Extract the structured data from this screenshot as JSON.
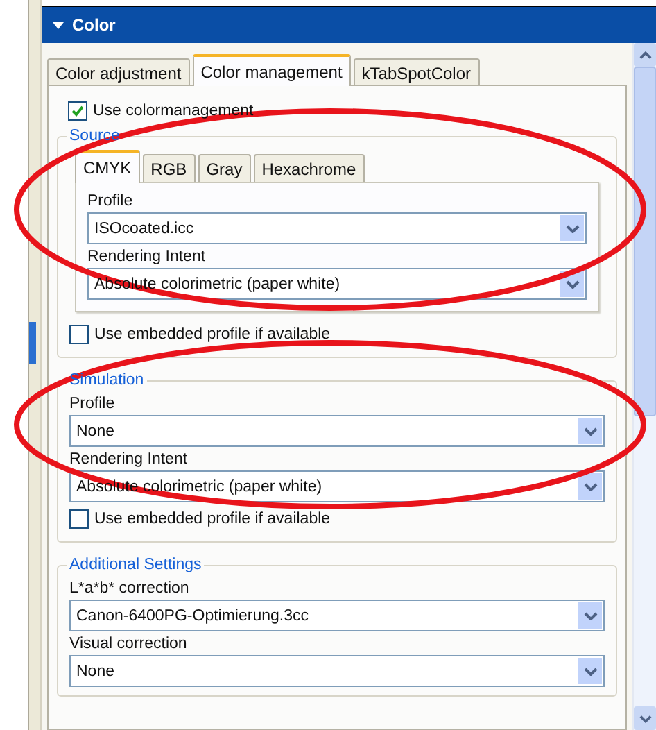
{
  "panel": {
    "title": "Color",
    "expanded": true
  },
  "tabs": [
    {
      "label": "Color adjustment",
      "selected": false
    },
    {
      "label": "Color management",
      "selected": true
    },
    {
      "label": "kTabSpotColor",
      "selected": false
    }
  ],
  "use_colormanagement": {
    "label": "Use colormanagement",
    "checked": true
  },
  "source": {
    "title": "Source",
    "tabs": [
      {
        "label": "CMYK",
        "selected": true
      },
      {
        "label": "RGB",
        "selected": false
      },
      {
        "label": "Gray",
        "selected": false
      },
      {
        "label": "Hexachrome",
        "selected": false
      }
    ],
    "fields": [
      {
        "label": "Profile",
        "value": "ISOcoated.icc"
      },
      {
        "label": "Rendering Intent",
        "value": "Absolute colorimetric (paper white)"
      }
    ],
    "embedded": {
      "label": "Use embedded profile if available",
      "checked": false
    }
  },
  "simulation": {
    "title": "Simulation",
    "fields": [
      {
        "label": "Profile",
        "value": "None"
      },
      {
        "label": "Rendering Intent",
        "value": "Absolute colorimetric (paper white)"
      }
    ],
    "embedded": {
      "label": "Use embedded profile if available",
      "checked": false
    }
  },
  "additional": {
    "title": "Additional Settings",
    "fields": [
      {
        "label": "L*a*b* correction",
        "value": "Canon-6400PG-Optimierung.3cc"
      },
      {
        "label": "Visual correction",
        "value": "None"
      }
    ]
  }
}
